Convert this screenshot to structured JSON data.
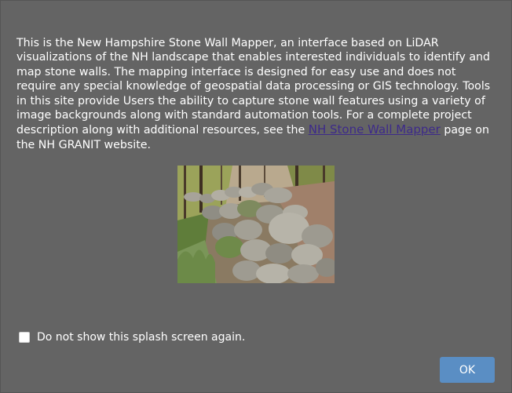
{
  "description": {
    "text_before_link": "This is the New Hampshire Stone Wall Mapper, an interface based on LiDAR visualizations of the NH landscape that enables interested individuals to identify and map stone walls. The mapping interface is designed for easy use and does not require any special knowledge of geospatial data processing or GIS technology. Tools in this site provide Users the ability to capture stone wall features using a variety of image backgrounds along with standard automation tools. For a complete project description along with additional resources, see the ",
    "link_text": "NH Stone Wall Mapper",
    "text_after_link": " page on the NH GRANIT website."
  },
  "checkbox": {
    "label": "Do not show this splash screen again.",
    "checked": false
  },
  "ok_button": {
    "label": "OK"
  },
  "colors": {
    "background": "#646464",
    "link": "#3d2a8a",
    "button": "#5a8ec4"
  }
}
